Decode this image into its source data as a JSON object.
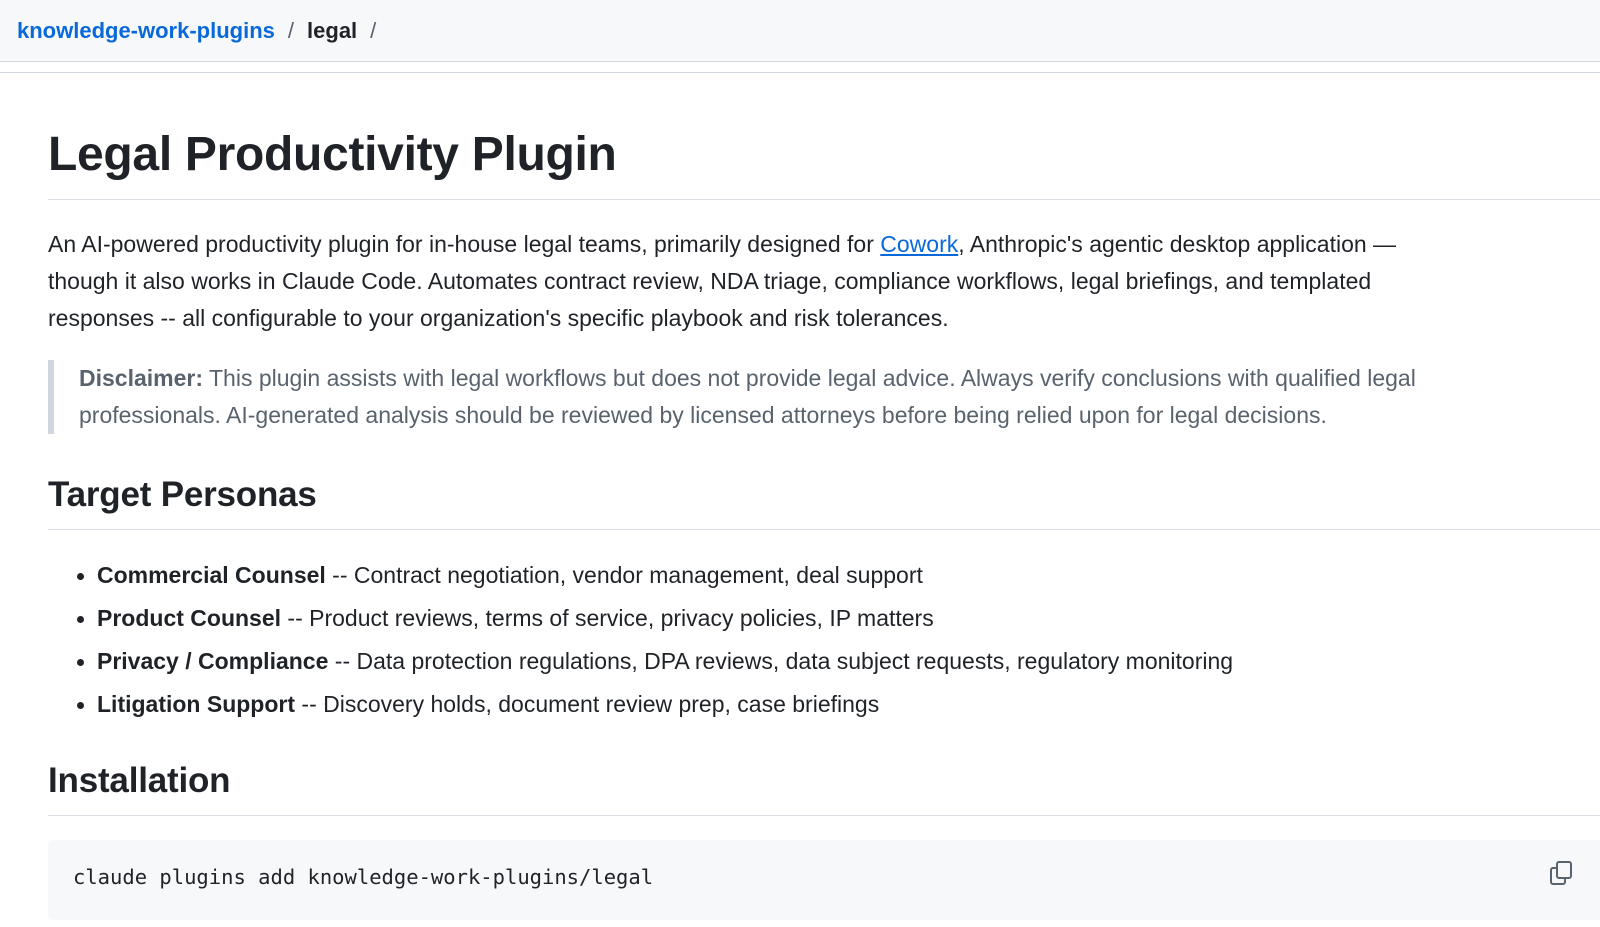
{
  "breadcrumb": {
    "repo": "knowledge-work-plugins",
    "separator": "/",
    "folder": "legal"
  },
  "readme": {
    "title": "Legal Productivity Plugin",
    "intro": {
      "before_link": "An AI-powered productivity plugin for in-house legal teams, primarily designed for ",
      "link_text": "Cowork",
      "after_link_line1": ", Anthropic's agentic desktop application —",
      "line2": "though it also works in Claude Code. Automates contract review, NDA triage, compliance workflows, legal briefings, and templated",
      "line3": "responses -- all configurable to your organization's specific playbook and risk tolerances."
    },
    "disclaimer": {
      "label": "Disclaimer:",
      "line1": " This plugin assists with legal workflows but does not provide legal advice. Always verify conclusions with qualified legal",
      "line2": "professionals. AI-generated analysis should be reviewed by licensed attorneys before being relied upon for legal decisions."
    },
    "personas": {
      "heading": "Target Personas",
      "items": [
        {
          "name": "Commercial Counsel",
          "desc": " -- Contract negotiation, vendor management, deal support"
        },
        {
          "name": "Product Counsel",
          "desc": " -- Product reviews, terms of service, privacy policies, IP matters"
        },
        {
          "name": "Privacy / Compliance",
          "desc": " -- Data protection regulations, DPA reviews, data subject requests, regulatory monitoring"
        },
        {
          "name": "Litigation Support",
          "desc": " -- Discovery holds, document review prep, case briefings"
        }
      ]
    },
    "installation": {
      "heading": "Installation",
      "command": "claude plugins add knowledge-work-plugins/legal",
      "copy_icon": "copy-icon"
    }
  },
  "colors": {
    "link": "#0969da",
    "text": "#1f2328",
    "muted": "#59636e",
    "border": "#d0d7de",
    "code_bg": "#f6f8fa"
  }
}
